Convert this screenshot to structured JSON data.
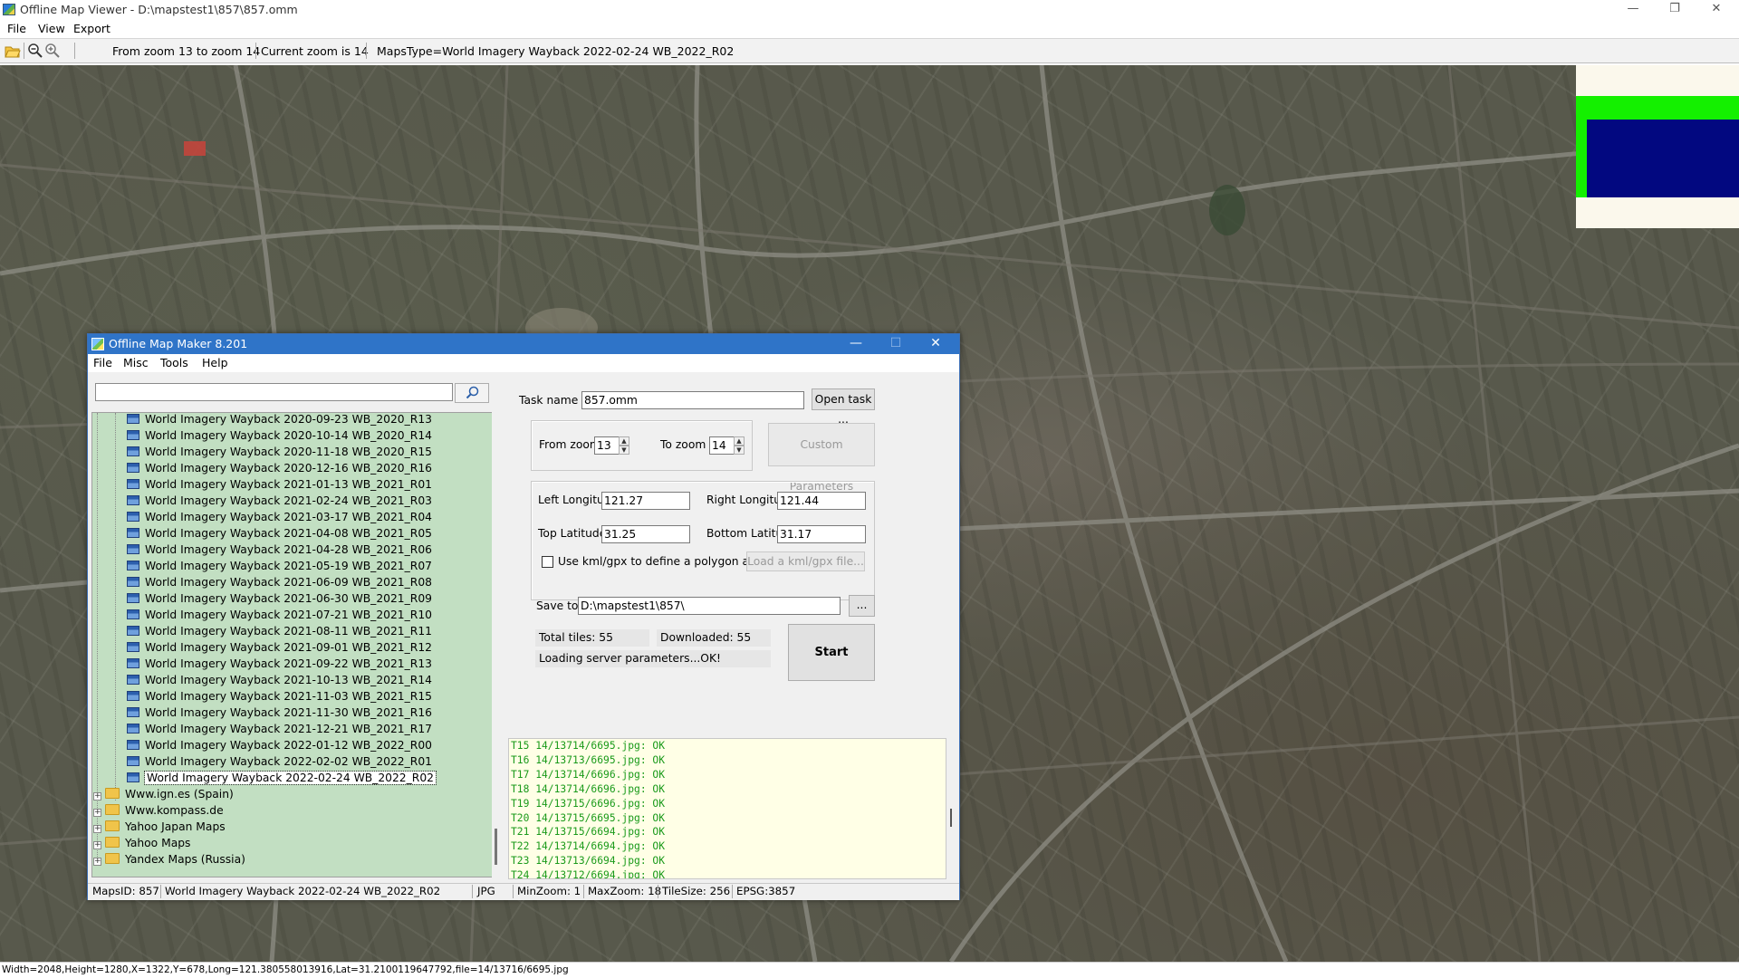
{
  "app": {
    "title": "Offline Map Viewer - D:\\mapstest1\\857\\857.omm",
    "menu": [
      "File",
      "View",
      "Export"
    ],
    "window_buttons": [
      "—",
      "❐",
      "✕"
    ]
  },
  "toolbar": {
    "zoom_range": "From zoom 13 to zoom 14",
    "current_zoom": "Current zoom is 14",
    "maps_type": "MapsType=World Imagery Wayback 2022-02-24 WB_2022_R02"
  },
  "status_bar": "Width=2048,Height=1280,X=1322,Y=678,Long=121.380558013916,Lat=31.2100119647792,file=14/13716/6695.jpg",
  "dialog": {
    "title": "Offline Map Maker 8.201",
    "menu": [
      "File",
      "Misc",
      "Tools",
      "Help"
    ],
    "window_buttons": [
      "—",
      "☐",
      "✕"
    ],
    "search": {
      "value": "",
      "icon": "search-icon"
    },
    "tree_items": [
      "World Imagery Wayback 2020-09-23 WB_2020_R13",
      "World Imagery Wayback 2020-10-14 WB_2020_R14",
      "World Imagery Wayback 2020-11-18 WB_2020_R15",
      "World Imagery Wayback 2020-12-16 WB_2020_R16",
      "World Imagery Wayback 2021-01-13 WB_2021_R01",
      "World Imagery Wayback 2021-02-24 WB_2021_R03",
      "World Imagery Wayback 2021-03-17 WB_2021_R04",
      "World Imagery Wayback 2021-04-08 WB_2021_R05",
      "World Imagery Wayback 2021-04-28 WB_2021_R06",
      "World Imagery Wayback 2021-05-19 WB_2021_R07",
      "World Imagery Wayback 2021-06-09 WB_2021_R08",
      "World Imagery Wayback 2021-06-30 WB_2021_R09",
      "World Imagery Wayback 2021-07-21 WB_2021_R10",
      "World Imagery Wayback 2021-08-11 WB_2021_R11",
      "World Imagery Wayback 2021-09-01 WB_2021_R12",
      "World Imagery Wayback 2021-09-22 WB_2021_R13",
      "World Imagery Wayback 2021-10-13 WB_2021_R14",
      "World Imagery Wayback 2021-11-03 WB_2021_R15",
      "World Imagery Wayback 2021-11-30 WB_2021_R16",
      "World Imagery Wayback 2021-12-21 WB_2021_R17",
      "World Imagery Wayback 2022-01-12 WB_2022_R00",
      "World Imagery Wayback 2022-02-02 WB_2022_R01",
      "World Imagery Wayback 2022-02-24 WB_2022_R02"
    ],
    "tree_selected": "World Imagery Wayback 2022-02-24 WB_2022_R02",
    "tree_folders": [
      "Www.ign.es (Spain)",
      "Www.kompass.de",
      "Yahoo Japan Maps",
      "Yahoo Maps",
      "Yandex Maps (Russia)"
    ],
    "task_name_label": "Task name",
    "task_name_value": "857.omm",
    "open_task_button": "Open task ...",
    "from_zoom_label": "From zoom",
    "from_zoom_value": "13",
    "to_zoom_label": "To zoom",
    "to_zoom_value": "14",
    "custom_params_button": "Custom Parameters",
    "left_lon_label": "Left Longitude",
    "left_lon_value": "121.27",
    "right_lon_label": "Right Longitude",
    "right_lon_value": "121.44",
    "top_lat_label": "Top Latitude",
    "top_lat_value": "31.25",
    "bottom_lat_label": "Bottom Latitude",
    "bottom_lat_value": "31.17",
    "kml_checkbox_label": "Use kml/gpx to define a polygon area",
    "load_kml_button": "Load a kml/gpx file...",
    "save_to_label": "Save to:",
    "save_to_value": "D:\\mapstest1\\857\\",
    "browse_button": "...",
    "total_tiles": "Total tiles: 55",
    "downloaded": "Downloaded: 55",
    "loading_status": "Loading server parameters...OK!",
    "start_button": "Start",
    "log_lines": [
      "T15 14/13714/6695.jpg: OK",
      "T16 14/13713/6695.jpg: OK",
      "T17 14/13714/6696.jpg: OK",
      "T18 14/13714/6696.jpg: OK",
      "T19 14/13715/6696.jpg: OK",
      "T20 14/13715/6695.jpg: OK",
      "T21 14/13715/6694.jpg: OK",
      "T22 14/13714/6694.jpg: OK",
      "T23 14/13713/6694.jpg: OK",
      "T24 14/13712/6694.jpg: OK"
    ],
    "status": {
      "maps_id": "MapsID: 857",
      "map_name": "World Imagery Wayback 2022-02-24 WB_2022_R02",
      "format": "JPG",
      "min_zoom": "MinZoom: 1",
      "max_zoom": "MaxZoom: 18",
      "tile_size": "TileSize: 256",
      "epsg": "EPSG:3857"
    }
  },
  "colors": {
    "dialog_titlebar": "#2f74c8",
    "tree_background": "#c2dfc2",
    "log_background": "#ffffe6",
    "log_text": "#1a9a1a",
    "minimap_green": "#14f000",
    "minimap_blue": "#020880"
  }
}
